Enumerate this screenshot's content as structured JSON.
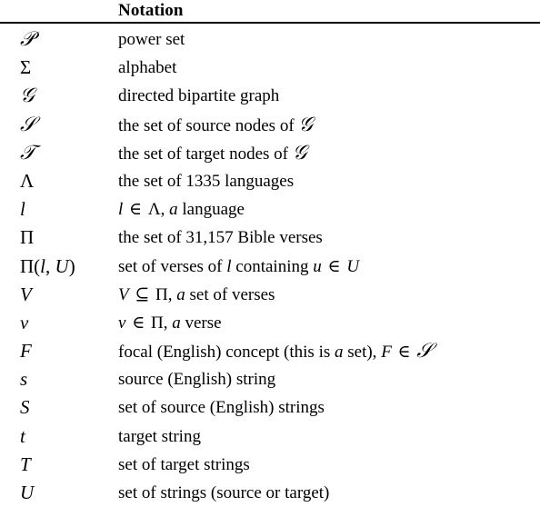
{
  "table": {
    "header": {
      "symbol_column": "",
      "notation_column": "Notation"
    },
    "rows": [
      {
        "symbol": "𝒫",
        "description": "power set"
      },
      {
        "symbol": "Σ",
        "description": "alphabet"
      },
      {
        "symbol": "𝒢",
        "description": "directed bipartite graph"
      },
      {
        "symbol": "𝒮",
        "description": "the set of source nodes of 𝒢"
      },
      {
        "symbol": "𝒯",
        "description": "the set of target nodes of 𝒢"
      },
      {
        "symbol": "Λ",
        "description": "the set of 1335 languages"
      },
      {
        "symbol": "l",
        "description": "l ∈ Λ, a language"
      },
      {
        "symbol": "Π",
        "description": "the set of 31,157 Bible verses"
      },
      {
        "symbol": "Π(l, U)",
        "description": "set of verses of l containing u ∈ U"
      },
      {
        "symbol": "V",
        "description": "V ⊆ Π, a set of verses"
      },
      {
        "symbol": "v",
        "description": "v ∈ Π, a verse"
      },
      {
        "symbol": "F",
        "description": "focal (English) concept (this is a set), F ∈ 𝒮"
      },
      {
        "symbol": "s",
        "description": "source (English) string"
      },
      {
        "symbol": "S",
        "description": "set of source (English) strings"
      },
      {
        "symbol": "t",
        "description": "target string"
      },
      {
        "symbol": "T",
        "description": "set of target strings"
      },
      {
        "symbol": "U",
        "description": "set of strings (source or target)"
      }
    ]
  },
  "style": {
    "text_color": "#000000",
    "background_color": "#ffffff",
    "rule_color": "#000000"
  }
}
